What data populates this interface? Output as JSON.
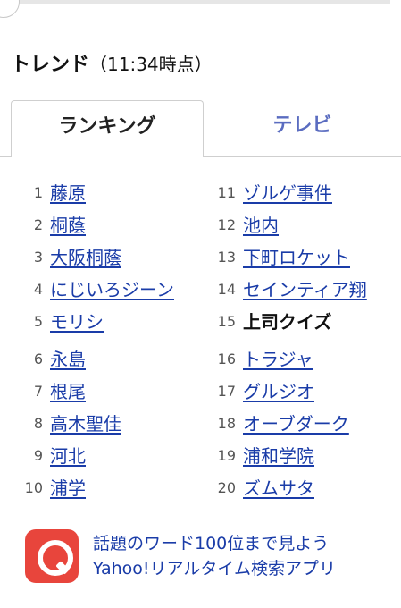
{
  "header": {
    "title": "トレンド",
    "time": "（11:34時点）"
  },
  "tabs": {
    "ranking": "ランキング",
    "tv": "テレビ"
  },
  "ranking": [
    {
      "rank": "1",
      "term": "藤原"
    },
    {
      "rank": "2",
      "term": "桐蔭"
    },
    {
      "rank": "3",
      "term": "大阪桐蔭"
    },
    {
      "rank": "4",
      "term": "にじいろジーン"
    },
    {
      "rank": "5",
      "term": "モリシ"
    },
    {
      "rank": "6",
      "term": "永島"
    },
    {
      "rank": "7",
      "term": "根尾"
    },
    {
      "rank": "8",
      "term": "高木聖佳"
    },
    {
      "rank": "9",
      "term": "河北"
    },
    {
      "rank": "10",
      "term": "浦学"
    },
    {
      "rank": "11",
      "term": "ゾルゲ事件"
    },
    {
      "rank": "12",
      "term": "池内"
    },
    {
      "rank": "13",
      "term": "下町ロケット"
    },
    {
      "rank": "14",
      "term": "セインティア翔"
    },
    {
      "rank": "15",
      "term": "上司クイズ"
    },
    {
      "rank": "16",
      "term": "トラジャ"
    },
    {
      "rank": "17",
      "term": "グルジオ"
    },
    {
      "rank": "18",
      "term": "オーブダーク"
    },
    {
      "rank": "19",
      "term": "浦和学院"
    },
    {
      "rank": "20",
      "term": "ズムサタ"
    }
  ],
  "promo": {
    "line1": "話題のワード100位まで見よう",
    "line2": "Yahoo!リアルタイム検索アプリ",
    "icon": "search-app-icon"
  },
  "colors": {
    "link": "#1a3ca8",
    "tab_inactive": "#5a6cc0",
    "icon_bg": "#e8453c"
  }
}
